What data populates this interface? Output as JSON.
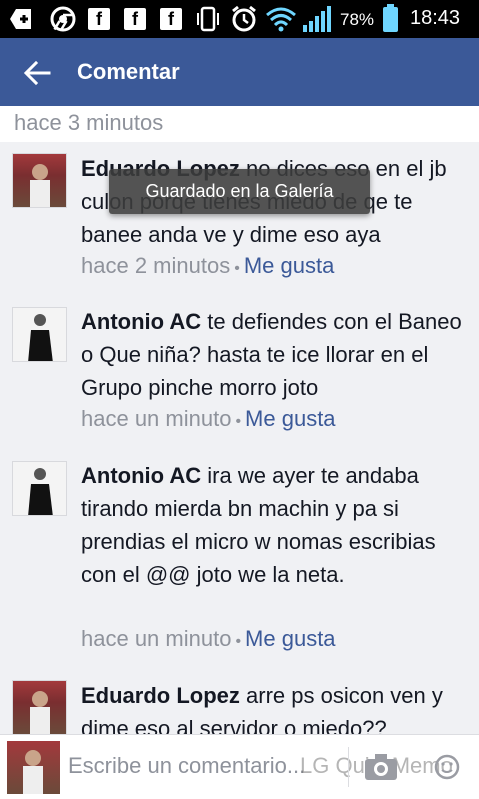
{
  "status_bar": {
    "battery_percent": "78%",
    "time": "18:43",
    "icons": [
      "add-icon",
      "chrome-icon",
      "facebook-icon",
      "facebook-icon",
      "facebook-icon",
      "vibrate-icon",
      "alarm-icon",
      "wifi-icon",
      "signal-icon",
      "battery-icon"
    ]
  },
  "app_bar": {
    "title": "Comentar",
    "color": "#3b5998"
  },
  "top_timestamp": "hace 3 minutos",
  "toast": "Guardado en la Galería",
  "comments": [
    {
      "author": "Eduardo Lopez",
      "text": "no dices eso en el jb culon porqe tienes miedo de qe te banee anda ve y dime eso aya",
      "time": "hace 2 minutos",
      "like": "Me gusta"
    },
    {
      "author": "Antonio AC",
      "text": "te defiendes con el Baneo o Que niña? hasta te ice llorar en el Grupo pinche morro joto",
      "time": "hace un minuto",
      "like": "Me gusta"
    },
    {
      "author": "Antonio AC",
      "text": "ira we ayer te andaba tirando mierda bn machin y pa si prendias el micro w nomas escribias con el @@ joto we la neta.",
      "time": "hace un minuto",
      "like": "Me gusta"
    },
    {
      "author": "Eduardo Lopez",
      "text": "arre ps osicon ven y dime eso al servidor o miedo??"
    }
  ],
  "composer": {
    "placeholder": "Escribe un comentario...",
    "watermark": "LG QuickMemo"
  },
  "colors": {
    "link": "#3b5998",
    "meta": "#8e929b",
    "text": "#141823"
  }
}
